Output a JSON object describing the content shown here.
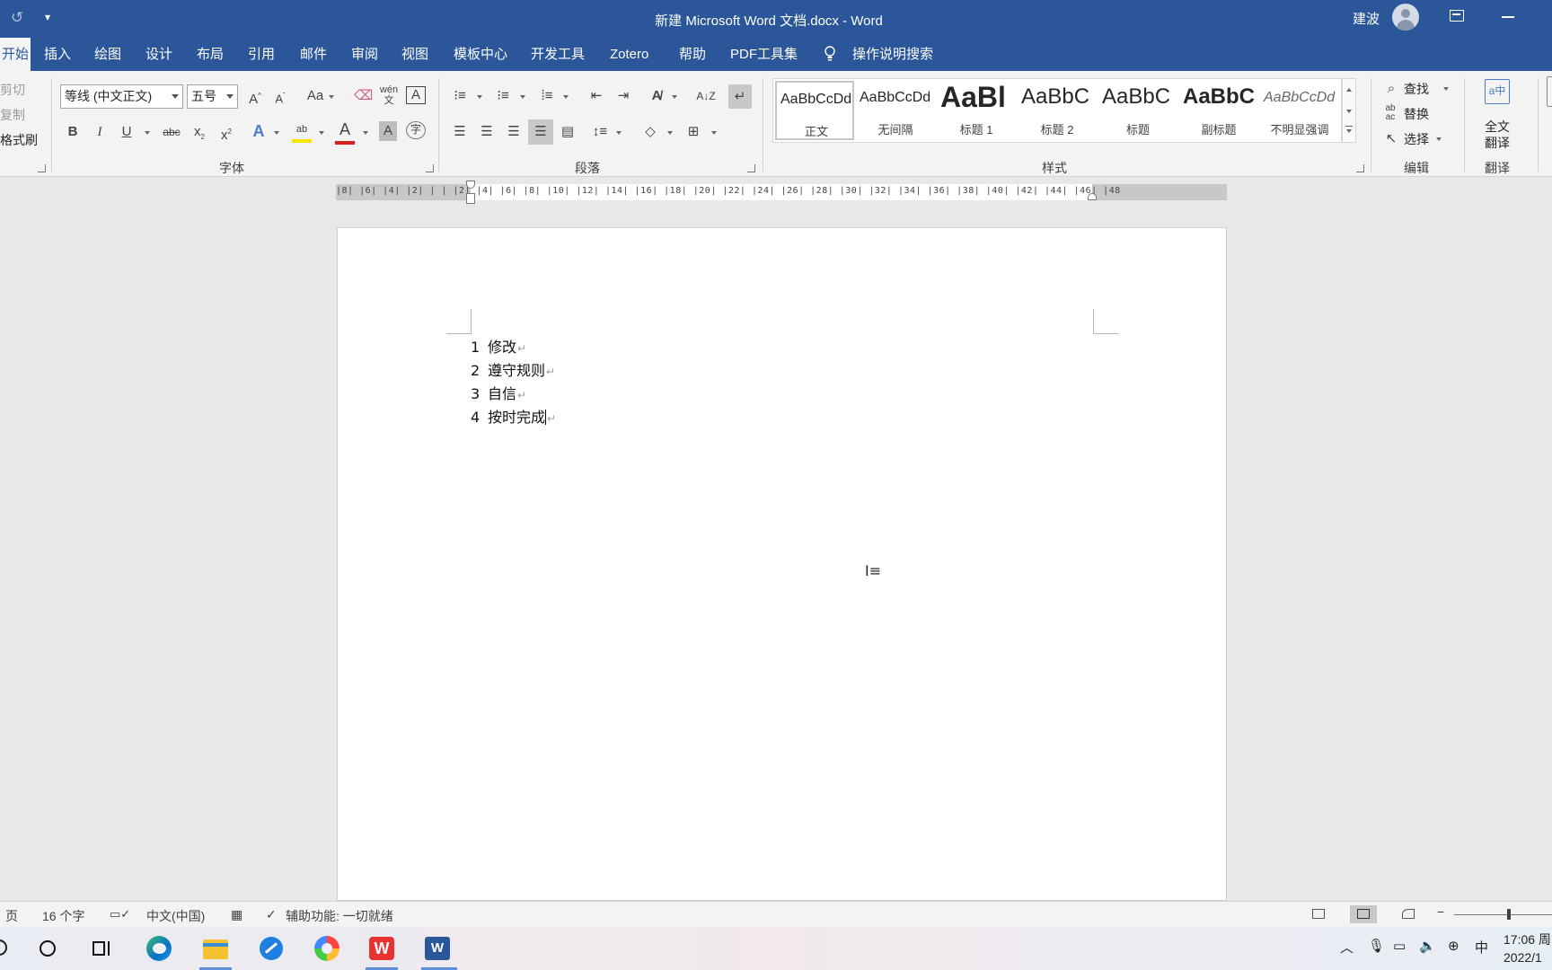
{
  "titlebar": {
    "title": "新建 Microsoft Word 文档.docx  -  Word",
    "user": "建波"
  },
  "tabs": [
    "开始",
    "插入",
    "绘图",
    "设计",
    "布局",
    "引用",
    "邮件",
    "审阅",
    "视图",
    "模板中心",
    "开发工具",
    "Zotero",
    "帮助",
    "PDF工具集",
    "操作说明搜索"
  ],
  "clipboard": {
    "cut": "剪切",
    "copy": "复制",
    "format_painter": "格式刷"
  },
  "font": {
    "name": "等线 (中文正文)",
    "size": "五号",
    "group_label": "字体",
    "bold": "B",
    "italic": "I",
    "underline": "U",
    "strike": "abc",
    "case": "Aa",
    "pinyin": "wén",
    "font_color_letter": "A",
    "highlight_color": "#f5e600",
    "font_color": "#d42020"
  },
  "paragraph": {
    "group_label": "段落"
  },
  "styles": {
    "group_label": "样式",
    "items": [
      {
        "sample": "AaBbCcDd",
        "name": "正文"
      },
      {
        "sample": "AaBbCcDd",
        "name": "无间隔"
      },
      {
        "sample": "AaBl",
        "name": "标题 1"
      },
      {
        "sample": "AaBbC",
        "name": "标题 2"
      },
      {
        "sample": "AaBbC",
        "name": "标题"
      },
      {
        "sample": "AaBbC",
        "name": "副标题"
      },
      {
        "sample": "AaBbCcDd",
        "name": "不明显强调"
      }
    ]
  },
  "editing": {
    "group_label": "编辑",
    "find": "查找",
    "replace": "替换",
    "select": "选择"
  },
  "translate": {
    "group_label": "翻译",
    "full_line1": "全文",
    "full_line2": "翻译"
  },
  "ruler": {
    "ticks": "|8|  |6|  |4|  |2|  | |  |2|  |4|  |6|  |8|  |10|  |12|  |14|  |16|  |18|  |20|  |22|  |24|  |26|  |28|  |30|  |32|  |34|  |36|  |38|  |40|  |42|  |44|  |46|  |48"
  },
  "document": {
    "items": [
      {
        "num": "1",
        "text": "修改"
      },
      {
        "num": "2",
        "text": "遵守规则"
      },
      {
        "num": "3",
        "text": "自信"
      },
      {
        "num": "4",
        "text": "按时完成"
      }
    ],
    "paragraph_mark": "↵"
  },
  "statusbar": {
    "page": "页",
    "words": "16 个字",
    "language": "中文(中国)",
    "accessibility": "辅助功能: 一切就绪"
  },
  "taskbar": {
    "time": "17:06 周",
    "date": "2022/1",
    "ime": "中",
    "apps": [
      "cortana",
      "task-view",
      "edge",
      "file-explorer",
      "feishu",
      "color-app",
      "wps",
      "word"
    ]
  },
  "colors": {
    "word_blue": "#2b579a",
    "ribbon_bg": "#f3f3f3"
  }
}
